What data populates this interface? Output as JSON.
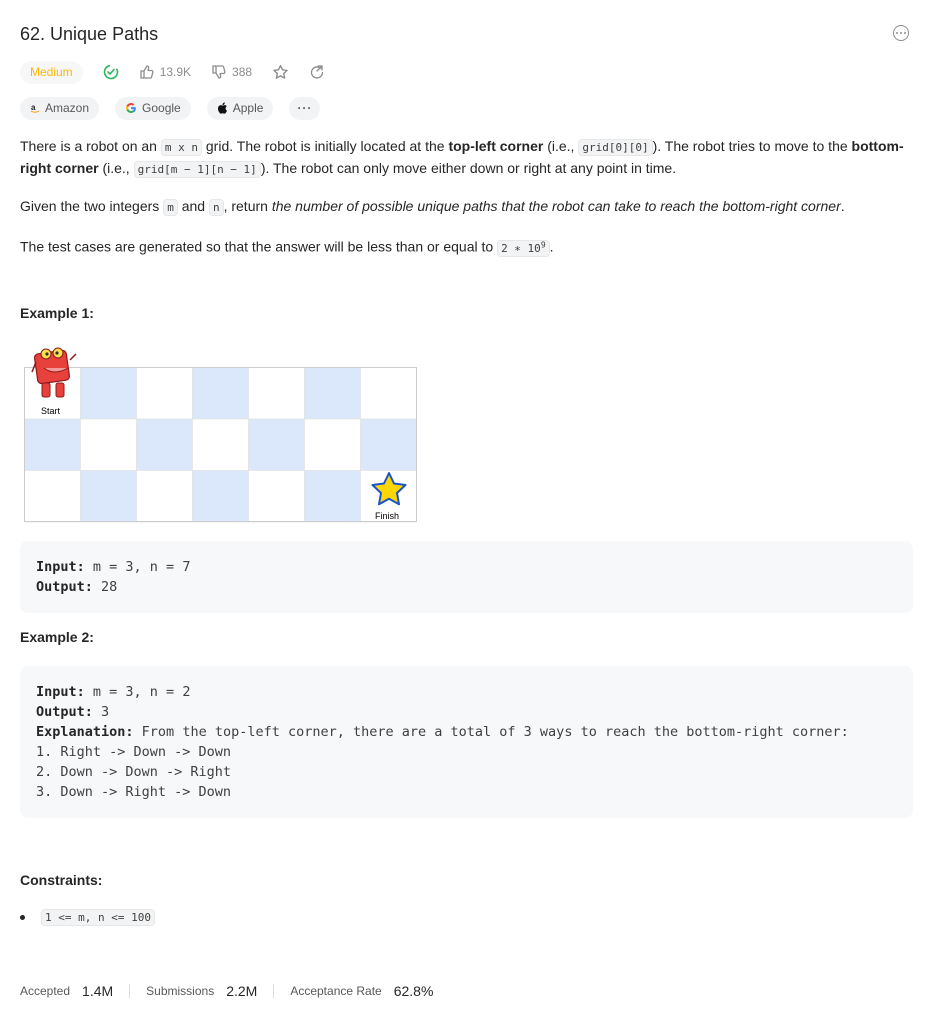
{
  "problem": {
    "title": "62. Unique Paths",
    "difficulty": "Medium",
    "likes": "13.9K",
    "dislikes": "388"
  },
  "tags": [
    "Amazon",
    "Google",
    "Apple"
  ],
  "tags_more": "···",
  "description": {
    "p1_a": "There is a robot on an ",
    "p1_code1": "m x n",
    "p1_b": " grid. The robot is initially located at the ",
    "p1_bold1": "top-left corner",
    "p1_c": " (i.e., ",
    "p1_code2": "grid[0][0]",
    "p1_d": "). The robot tries to move to the ",
    "p1_bold2": "bottom-right corner",
    "p1_e": " (i.e., ",
    "p1_code3": "grid[m − 1][n − 1]",
    "p1_f": "). The robot can only move either down or right at any point in time.",
    "p2_a": "Given the two integers ",
    "p2_code1": "m",
    "p2_b": " and ",
    "p2_code2": "n",
    "p2_c": ", return ",
    "p2_em": "the number of possible unique paths that the robot can take to reach the bottom-right corner",
    "p2_d": ".",
    "p3_a": "The test cases are generated so that the answer will be less than or equal to ",
    "p3_code": "2 ∗ 10",
    "p3_sup": "9",
    "p3_b": "."
  },
  "example1": {
    "title": "Example 1:",
    "start_label": "Start",
    "finish_label": "Finish",
    "input_label": "Input:",
    "input_value": " m = 3, n = 7",
    "output_label": "Output:",
    "output_value": " 28"
  },
  "example2": {
    "title": "Example 2:",
    "input_label": "Input:",
    "input_value": " m = 3, n = 2",
    "output_label": "Output:",
    "output_value": " 3",
    "explanation_label": "Explanation:",
    "explanation_value": " From the top-left corner, there are a total of 3 ways to reach the bottom-right corner:",
    "line1": "1. Right -> Down -> Down",
    "line2": "2. Down -> Down -> Right",
    "line3": "3. Down -> Right -> Down"
  },
  "constraints": {
    "title": "Constraints:",
    "item1": "1 <= m, n <= 100"
  },
  "stats": {
    "accepted_label": "Accepted",
    "accepted_value": "1.4M",
    "submissions_label": "Submissions",
    "submissions_value": "2.2M",
    "rate_label": "Acceptance Rate",
    "rate_value": "62.8%"
  },
  "colors": {
    "difficulty_medium": "#ffb800",
    "solved_green": "#2db55d",
    "cell_blue": "#dbe7fb"
  }
}
